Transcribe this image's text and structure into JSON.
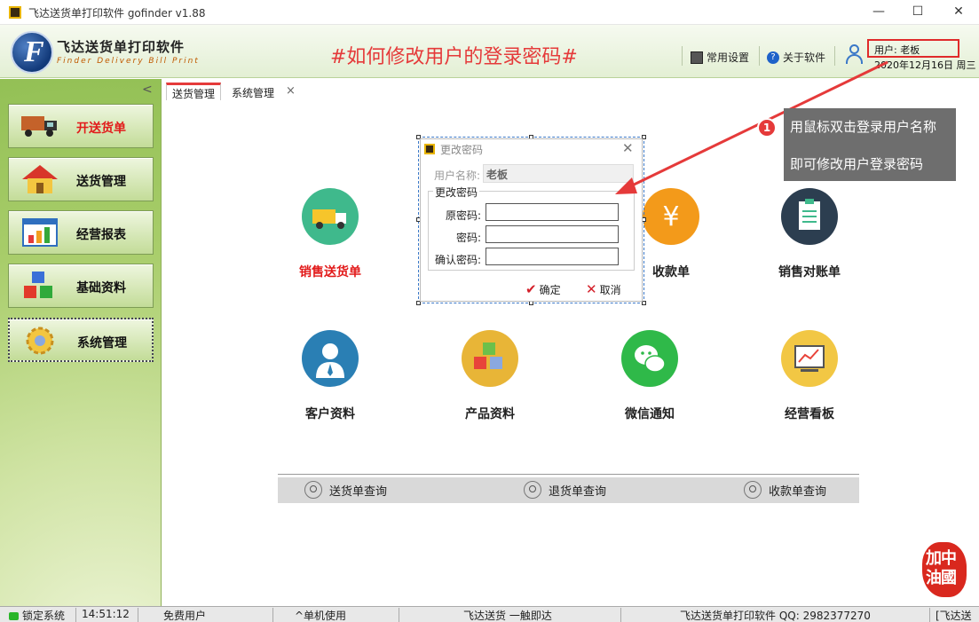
{
  "window": {
    "title": "飞达送货单打印软件  gofinder v1.88",
    "minimize": "—",
    "maximize": "☐",
    "close": "✕"
  },
  "header": {
    "logo_cn": "飞达送货单打印软件",
    "logo_en": "Finder Delivery Bill Print",
    "banner": "#如何修改用户的登录密码#",
    "settings_label": "常用设置",
    "about_label": "关于软件",
    "user_label": "用户: 老板",
    "date": "2020年12月16日 周三"
  },
  "sidebar": {
    "collapse": "<",
    "items": [
      {
        "label": "开送货单",
        "icon": "truck-icon",
        "active_color": "#e21a1a"
      },
      {
        "label": "送货管理",
        "icon": "house-icon"
      },
      {
        "label": "经营报表",
        "icon": "chart-icon"
      },
      {
        "label": "基础资料",
        "icon": "cubes-icon"
      },
      {
        "label": "系统管理",
        "icon": "gear-icon"
      }
    ]
  },
  "tabs": [
    {
      "label": "送货管理"
    },
    {
      "label": "系统管理"
    }
  ],
  "tab_close": "×",
  "tiles": [
    {
      "label": "销售送货单",
      "color": "#3fb98c"
    },
    {
      "label": "收款单",
      "color": "#f39a1a"
    },
    {
      "label": "销售对账单",
      "color": "#2c3e50"
    },
    {
      "label": "客户资料",
      "color": "#2a7fb4"
    },
    {
      "label": "产品资料",
      "color": "#e8b537"
    },
    {
      "label": "微信通知",
      "color": "#2fb949"
    },
    {
      "label": "经营看板",
      "color": "#f2c744"
    }
  ],
  "query_bar": {
    "delivery": "送货单查询",
    "return": "退货单查询",
    "receipt": "收款单查询"
  },
  "dialog": {
    "title": "更改密码",
    "close": "✕",
    "username_label": "用户名称:",
    "username_value": "老板",
    "group_label": "更改密码",
    "old_password_label": "原密码:",
    "password_label": "密码:",
    "confirm_password_label": "确认密码:",
    "ok": "确定",
    "cancel": "取消"
  },
  "callout": {
    "number": "1",
    "line1": "用鼠标双击登录用户名称",
    "line2": "即可修改用户登录密码"
  },
  "stamp": {
    "text1": "加中",
    "text2": "油國"
  },
  "statusbar": {
    "lock": "锁定系统",
    "time": "14:51:12",
    "user_type": "免费用户",
    "mode": "^单机使用",
    "slogan": "飞达送货 一触即达",
    "contact": "飞达送货单打印软件 QQ: 2982377270",
    "extra": "[飞达送"
  }
}
